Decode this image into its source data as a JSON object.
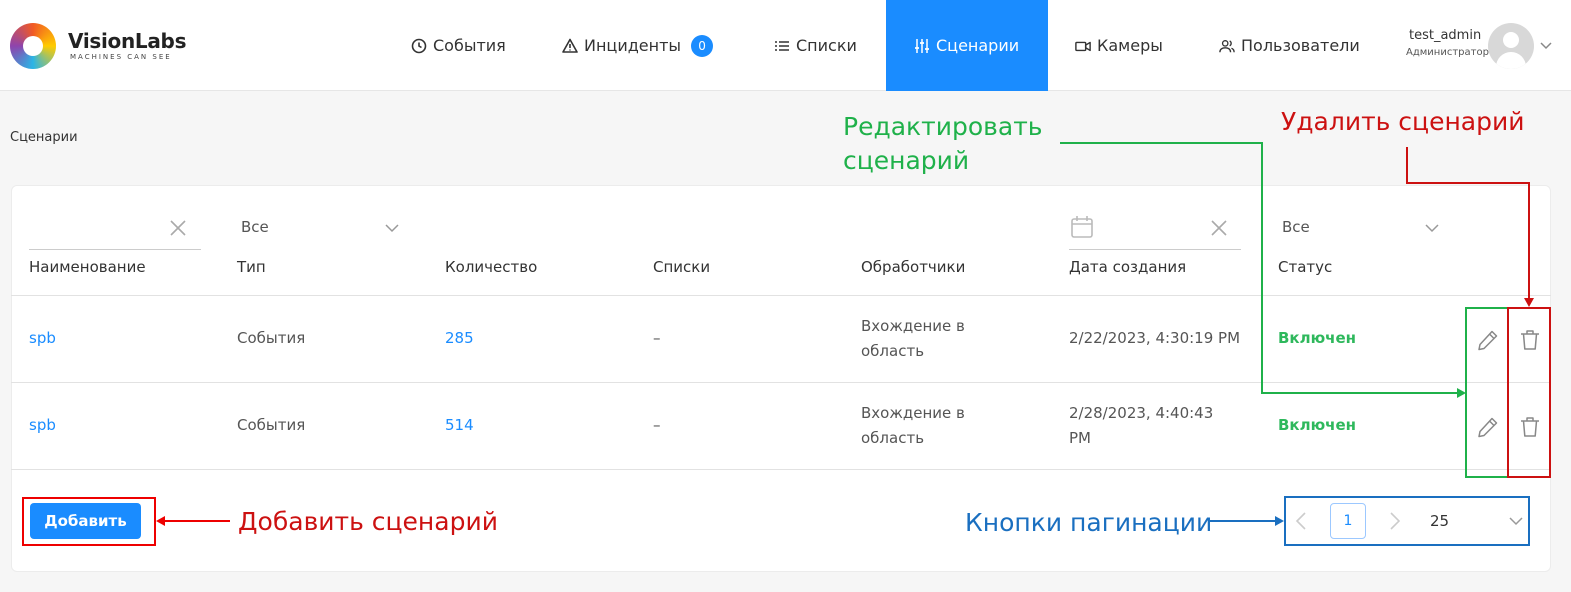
{
  "header": {
    "brand": "VisionLabs",
    "tagline": "MACHINES CAN SEE",
    "nav": {
      "events": "События",
      "incidents": "Инциденты",
      "incidents_badge": "0",
      "lists": "Списки",
      "scenarios": "Сценарии",
      "cameras": "Камеры",
      "users": "Пользователи"
    },
    "user": {
      "name": "test_admin",
      "role": "Администратор"
    }
  },
  "breadcrumb": "Сценарии",
  "filters": {
    "type_value": "Все",
    "status_value": "Все"
  },
  "columns": [
    "Наименование",
    "Тип",
    "Количество",
    "Списки",
    "Обработчики",
    "Дата создания",
    "Статус"
  ],
  "rows": [
    {
      "name": "spb",
      "type": "События",
      "count": "285",
      "lists": "–",
      "handlers": "Вхождение в область",
      "created": "2/22/2023, 4:30:19 PM",
      "status": "Включен"
    },
    {
      "name": "spb",
      "type": "События",
      "count": "514",
      "lists": "–",
      "handlers": "Вхождение в область",
      "created": "2/28/2023, 4:40:43 PM",
      "status": "Включен"
    }
  ],
  "add_button": "Добавить",
  "pagination": {
    "current_page": "1",
    "page_size": "25"
  },
  "annotations": {
    "edit": "Редактировать сценарий",
    "delete": "Удалить сценарий",
    "add": "Добавить сценарий",
    "pagination": "Кнопки пагинации"
  },
  "colors": {
    "accent": "#1a8cff",
    "status_enabled": "#2eb85c",
    "annotation_green": "#1fb14a",
    "annotation_red": "#cc1111",
    "annotation_blue": "#1a6fc0"
  },
  "icons": [
    "clock-icon",
    "warning-icon",
    "list-icon",
    "sliders-icon",
    "camera-icon",
    "users-icon",
    "edit-icon",
    "trash-icon",
    "calendar-icon",
    "close-icon",
    "chevron-down-icon",
    "chevron-left-icon",
    "chevron-right-icon"
  ]
}
